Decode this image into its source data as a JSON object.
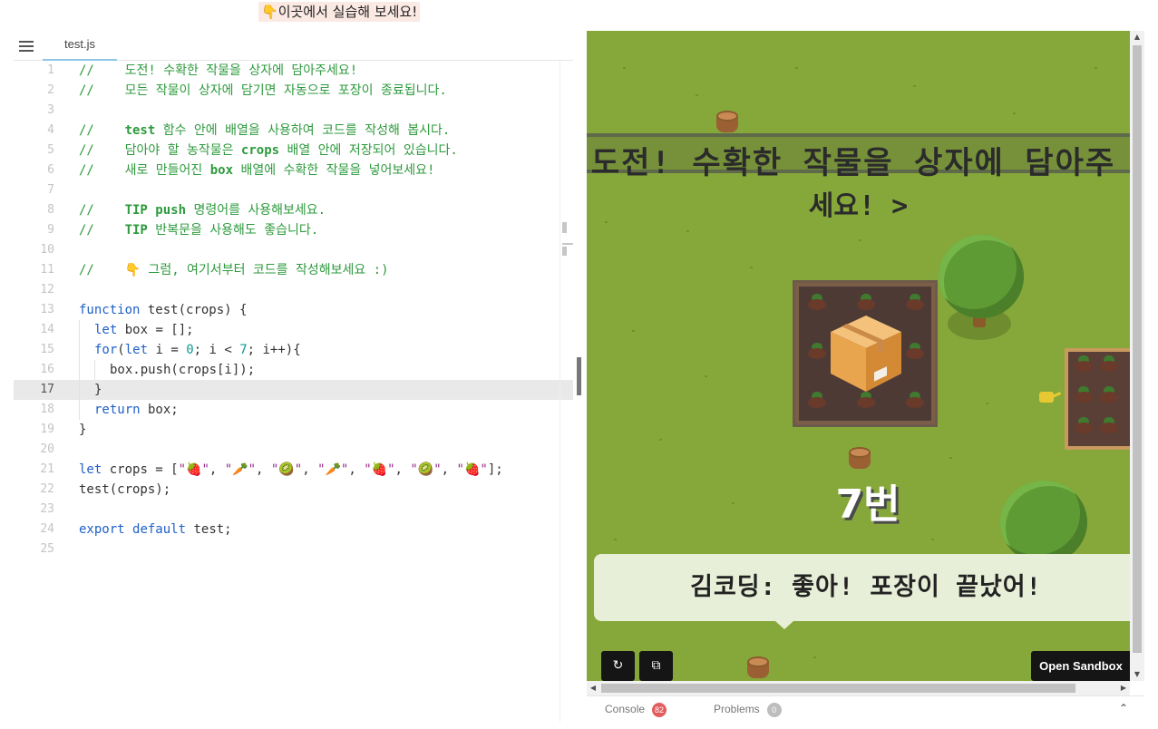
{
  "banner": {
    "hand": "👇",
    "text": "이곳에서 실습해 보세요!"
  },
  "editor": {
    "file_tab": "test.js",
    "active_line": 17,
    "lines": [
      {
        "n": "1"
      },
      {
        "n": "2"
      },
      {
        "n": "3"
      },
      {
        "n": "4"
      },
      {
        "n": "5"
      },
      {
        "n": "6"
      },
      {
        "n": "7"
      },
      {
        "n": "8"
      },
      {
        "n": "9"
      },
      {
        "n": "10"
      },
      {
        "n": "11"
      },
      {
        "n": "12"
      },
      {
        "n": "13"
      },
      {
        "n": "14"
      },
      {
        "n": "15"
      },
      {
        "n": "16"
      },
      {
        "n": "17"
      },
      {
        "n": "18"
      },
      {
        "n": "19"
      },
      {
        "n": "20"
      },
      {
        "n": "21"
      },
      {
        "n": "22"
      },
      {
        "n": "23"
      },
      {
        "n": "24"
      },
      {
        "n": "25"
      }
    ],
    "code": {
      "l1": "//    도전! 수확한 작물을 상자에 담아주세요!",
      "l2": "//    모든 작물이 상자에 담기면 자동으로 포장이 종료됩니다.",
      "l4a": "//    ",
      "l4b": "test",
      "l4c": " 함수 안에 배열을 사용하여 코드를 작성해 봅시다.",
      "l5a": "//    담아야 할 농작물은 ",
      "l5b": "crops",
      "l5c": " 배열 안에 저장되어 있습니다.",
      "l6a": "//    새로 만들어진 ",
      "l6b": "box",
      "l6c": " 배열에 수확한 작물을 넣어보세요!",
      "l8a": "//    ",
      "l8b": "TIP push",
      "l8c": " 명령어를 사용해보세요.",
      "l9a": "//    ",
      "l9b": "TIP",
      "l9c": " 반복문을 사용해도 좋습니다.",
      "l11": "//    👇 그럼, 여기서부터 코드를 작성해보세요 :)",
      "l13a": "function",
      "l13b": " test(crops) {",
      "l14a": "let",
      "l14b": " box = [];",
      "l15a": "for",
      "l15b": "(",
      "l15c": "let",
      "l15d": " i = ",
      "l15e": "0",
      "l15f": "; i < ",
      "l15g": "7",
      "l15h": "; i++){",
      "l16": "box.push(crops[i]);",
      "l17": "}",
      "l18a": "return",
      "l18b": " box;",
      "l19": "}",
      "l21a": "let",
      "l21b": " crops = [",
      "l21c": "\"🍓\"",
      "l21d": "\"🥕\"",
      "l21e": "\"🥝\"",
      "l21f": "\"🥕\"",
      "l21g": "\"🍓\"",
      "l21h": "\"🥝\"",
      "l21i": "\"🍓\"",
      "l21sep": ", ",
      "l21end": "];",
      "l22": "test(crops);",
      "l24a": "export",
      "l24b": " ",
      "l24c": "default",
      "l24d": " test;"
    }
  },
  "game": {
    "sign_line1": "도전! 수확한 작물을 상자에 담아주",
    "sign_line2": "세요! >",
    "stage_label": "7번",
    "speech": "김코딩: 좋아! 포장이 끝났어!",
    "refresh_icon": "↻",
    "open_new_icon": "⧉",
    "open_sandbox": "Open Sandbox"
  },
  "bottom": {
    "console_label": "Console",
    "console_count": "82",
    "problems_label": "Problems",
    "problems_count": "0",
    "collapse_icon": "⌃"
  },
  "colors": {
    "comment": "#2d9a3d",
    "keyword": "#2060c8",
    "number": "#0f9a8f",
    "string": "#9c2c8d",
    "grass": "#86a83a",
    "console_badge": "#e35d5d",
    "problems_badge": "#bdbdbd"
  }
}
